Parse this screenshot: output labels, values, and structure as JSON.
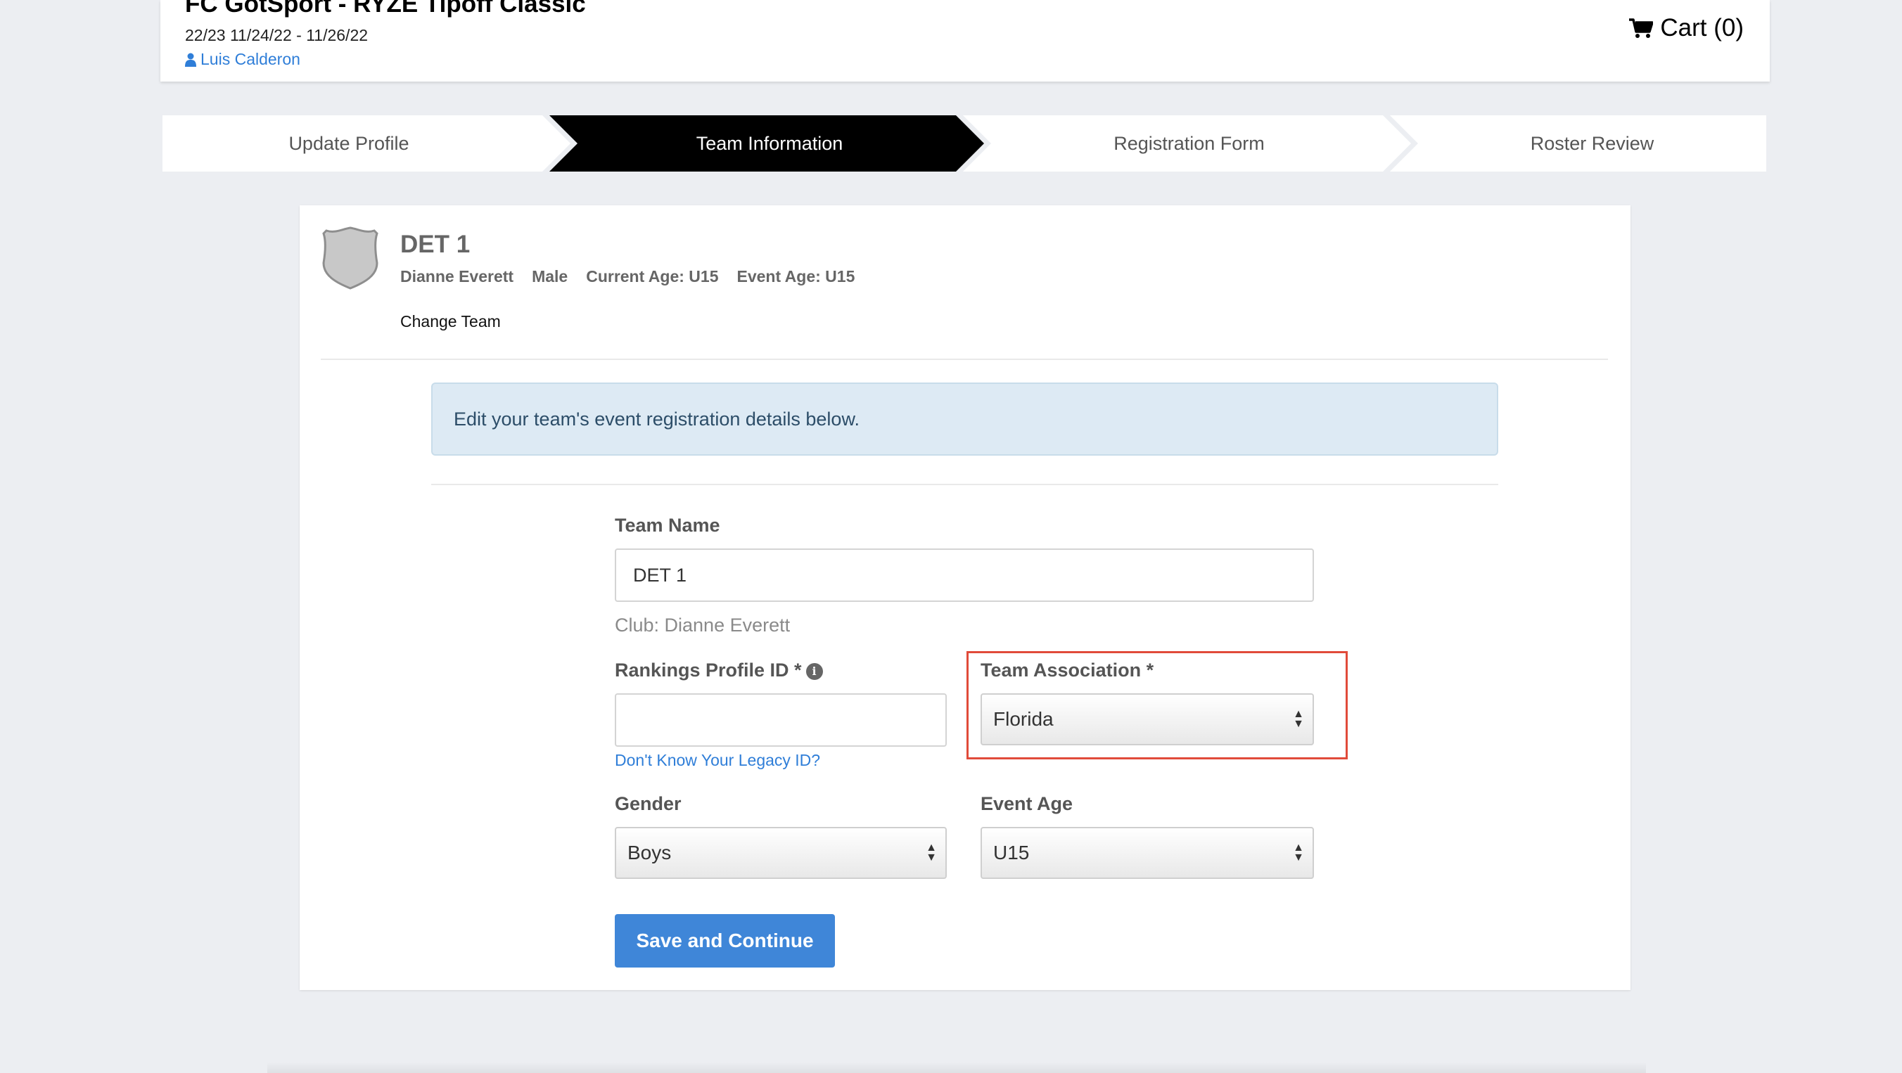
{
  "header": {
    "event_title": "FC GotSport - RYZE Tipoff Classic",
    "event_dates": "22/23 11/24/22 - 11/26/22",
    "user_name": "Luis Calderon",
    "cart_label": "Cart (0)"
  },
  "steps": [
    {
      "label": "Update Profile",
      "active": false
    },
    {
      "label": "Team Information",
      "active": true
    },
    {
      "label": "Registration Form",
      "active": false
    },
    {
      "label": "Roster Review",
      "active": false
    }
  ],
  "team": {
    "name": "DET 1",
    "club": "Dianne Everett",
    "gender": "Male",
    "current_age": "Current Age: U15",
    "event_age": "Event Age: U15",
    "change_team": "Change Team"
  },
  "alert": "Edit your team's event registration details below.",
  "form": {
    "team_name_label": "Team Name",
    "team_name_value": "DET 1",
    "club_help": "Club: Dianne Everett",
    "rankings_label": "Rankings Profile ID *",
    "rankings_value": "",
    "legacy_link": "Don't Know Your Legacy ID?",
    "association_label": "Team Association *",
    "association_value": "Florida",
    "gender_label": "Gender",
    "gender_value": "Boys",
    "event_age_label": "Event Age",
    "event_age_value": "U15",
    "save_label": "Save and Continue"
  },
  "colors": {
    "accent": "#3f86d8",
    "link": "#2f7ed8",
    "active_step_bg": "#000000",
    "highlight_border": "#e14b3a",
    "alert_bg": "#ddeaf4"
  },
  "icons": [
    "user-icon",
    "cart-icon",
    "shield-icon",
    "info-icon",
    "select-arrows-icon"
  ]
}
